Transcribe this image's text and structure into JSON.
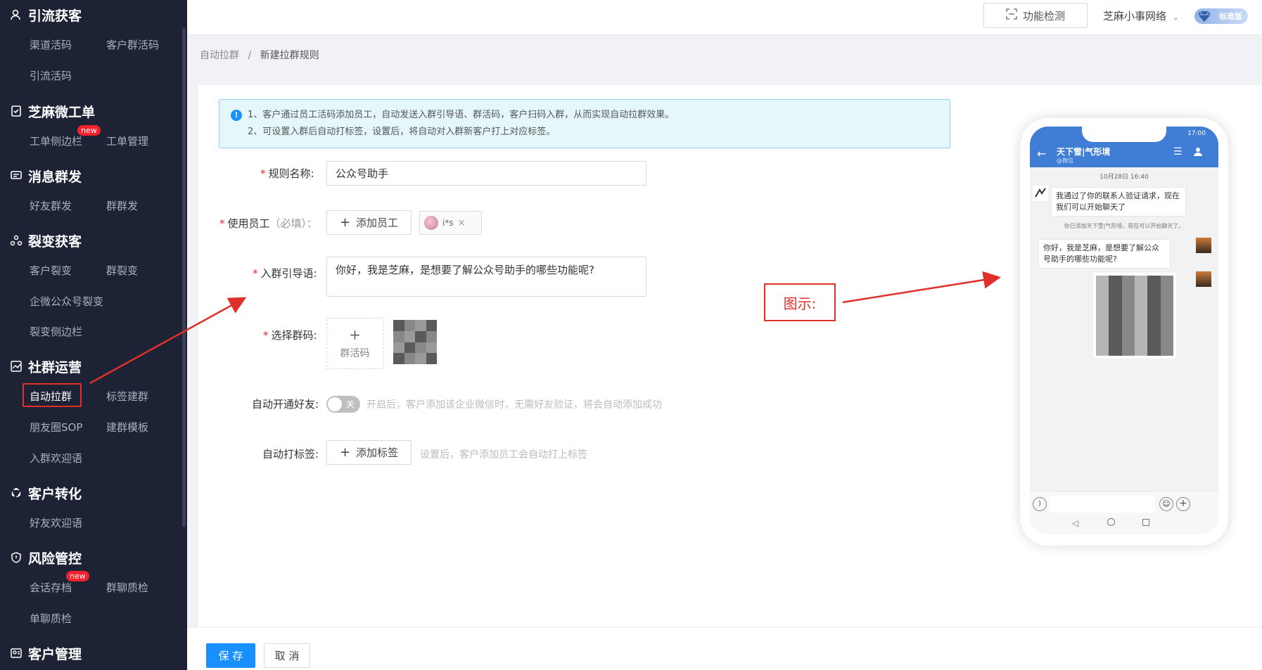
{
  "sidebar": {
    "sections": [
      {
        "title": "引流获客",
        "items": [
          "渠道活码",
          "客户群活码",
          "引流活码"
        ]
      },
      {
        "title": "芝麻微工单",
        "items": [
          "工单侧边栏",
          "工单管理"
        ],
        "badge": "new"
      },
      {
        "title": "消息群发",
        "items": [
          "好友群发",
          "群群发"
        ]
      },
      {
        "title": "裂变获客",
        "items": [
          "客户裂变",
          "群裂变",
          "企微公众号裂变",
          "裂变侧边栏"
        ]
      },
      {
        "title": "社群运营",
        "items": [
          "自动拉群",
          "标签建群",
          "朋友圈SOP",
          "建群模板",
          "入群欢迎语"
        ]
      },
      {
        "title": "客户转化",
        "items": [
          "好友欢迎语"
        ]
      },
      {
        "title": "风险管控",
        "items": [
          "会话存档",
          "群聊质检",
          "单聊质检"
        ],
        "badge": "new"
      },
      {
        "title": "客户管理",
        "items": []
      }
    ]
  },
  "topbar": {
    "check_label": "功能检测",
    "org_name": "芝麻小事网络",
    "vip_label": "标准版"
  },
  "breadcrumb": {
    "parent": "自动拉群",
    "sep": "/",
    "current": "新建拉群规则"
  },
  "alert": {
    "line1": "1、客户通过员工活码添加员工，自动发送入群引导语、群活码，客户扫码入群，从而实现自动拉群效果。",
    "line2": "2、可设置入群后自动打标签，设置后，将自动对入群新客户打上对应标签。"
  },
  "form": {
    "rule_name_label": "规则名称:",
    "rule_name_value": "公众号助手",
    "staff_label": "使用员工",
    "staff_required": "（必填）：",
    "add_staff": "添加员工",
    "staff_tag": "i*s",
    "guide_label": "入群引导语:",
    "guide_value": "你好，我是芝麻，是想要了解公众号助手的哪些功能呢?",
    "group_code_label": "选择群码:",
    "group_code_add": "群活码",
    "auto_friend_label": "自动开通好友:",
    "toggle_text": "关",
    "auto_friend_hint": "开启后，客户添加该企业微信时，无需好友验证，将会自动添加成功",
    "auto_tag_label": "自动打标签:",
    "add_tag": "添加标签",
    "auto_tag_hint": "设置后，客户添加员工会自动打上标签"
  },
  "illustration": {
    "label": "图示:"
  },
  "phone": {
    "status_time": "17:00",
    "chat_title": "天下雪|气形境",
    "chat_sub": "@微信",
    "date": "10月28日 16:40",
    "msg1": "我通过了你的联系人验证请求，现在我们可以开始聊天了",
    "sys": "你已添加天下雪|气形境，现在可以开始聊天了。",
    "msg2": "你好，我是芝麻，是想要了解公众号助手的哪些功能呢?"
  },
  "footer": {
    "save": "保 存",
    "cancel": "取 消"
  }
}
